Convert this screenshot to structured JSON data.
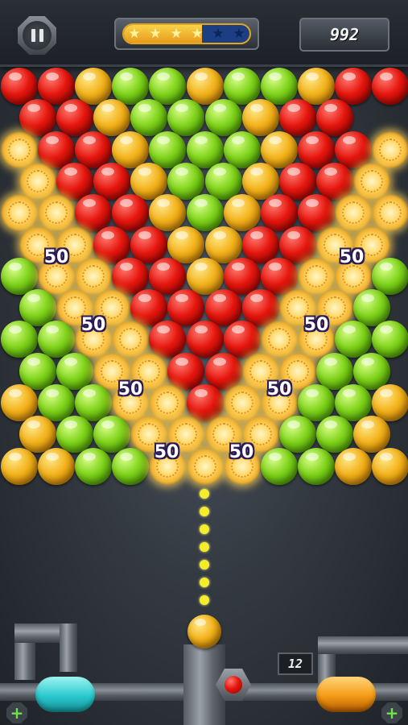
{
  "hud": {
    "score": "992",
    "stars_earned": 4,
    "stars_total": 6,
    "star_progress": 0.62,
    "shots_left": "12"
  },
  "icons": {
    "pause": "pause-icon",
    "star": "star-icon",
    "boost_left": "plus-icon",
    "boost_right": "plus-icon"
  },
  "colors": {
    "red": "#e6160e",
    "yellow": "#f3b21a",
    "green": "#7fd31a",
    "aim_dots": "#f5ec2a",
    "score_popup": "#ffffff"
  },
  "board": {
    "rows": [
      "RRYGGYGGYRR",
      "RRYGGGYRR",
      "BRRYGGGYRRB",
      "BRRYGGYRRB",
      "BBRRYGYRRBB",
      "BBRRYYRRBB",
      "GBBRRYRRBBG",
      "GBBRRRRBBG",
      "GGBBRRRBBGG",
      "GGBBRRBBGG",
      "YGGBBRBBGGY",
      "YGGBBBBGGY",
      "YYGGBBBGGYY"
    ],
    "legend": {
      "R": "red",
      "Y": "yellow",
      "G": "green",
      "B": "popping"
    }
  },
  "score_popups": [
    "50",
    "50",
    "50",
    "50",
    "50",
    "50",
    "50",
    "50"
  ],
  "shooter": {
    "current": "yellow",
    "next": "red"
  }
}
